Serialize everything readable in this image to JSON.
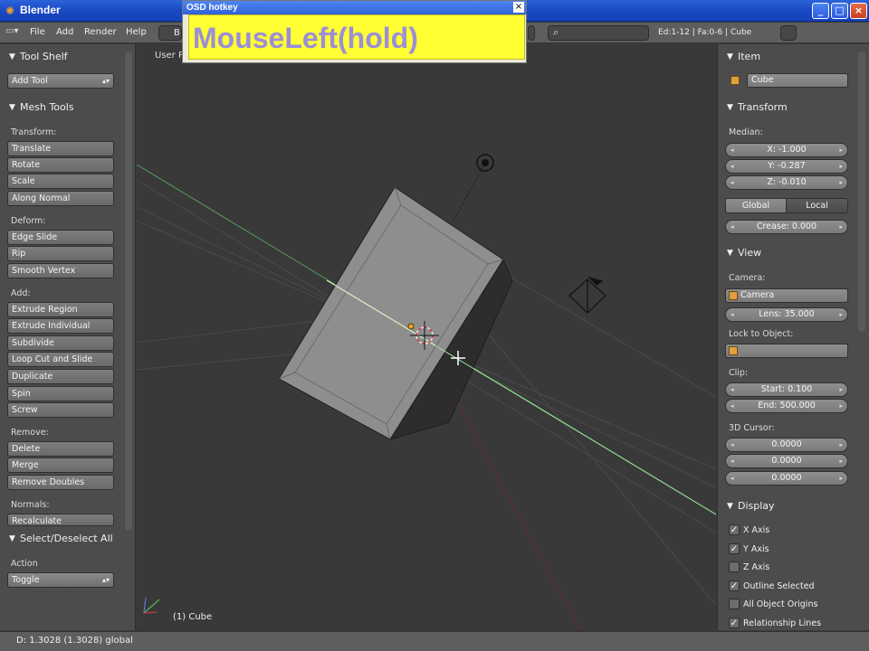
{
  "window": {
    "title": "Blender",
    "buttons": [
      "_",
      "□",
      "×"
    ]
  },
  "menubar": {
    "items": [
      "File",
      "Add",
      "Render",
      "Help"
    ],
    "layout_stub": "B",
    "stats": "Ed:1-12 | Fa:0-6 | Cube"
  },
  "osd": {
    "title": "OSD hotkey",
    "text": "MouseLeft(hold)",
    "close": "×"
  },
  "toolshelf": {
    "tool_shelf": "Tool Shelf",
    "add_tool": "Add Tool",
    "mesh_tools": "Mesh Tools",
    "transform_label": "Transform:",
    "transform": [
      "Translate",
      "Rotate",
      "Scale",
      "Along Normal"
    ],
    "deform_label": "Deform:",
    "deform": [
      "Edge Slide",
      "Rip",
      "Smooth Vertex"
    ],
    "add_label": "Add:",
    "add": [
      "Extrude Region",
      "Extrude Individual",
      "Subdivide",
      "Loop Cut and Slide",
      "Duplicate",
      "Spin",
      "Screw"
    ],
    "remove_label": "Remove:",
    "remove": [
      "Delete",
      "Merge",
      "Remove Doubles"
    ],
    "normals_label": "Normals:",
    "normals": [
      "Recalculate"
    ],
    "select_all": "Select/Deselect All",
    "action_label": "Action",
    "action_value": "Toggle"
  },
  "viewport": {
    "view_label": "User P",
    "object_label": "(1) Cube"
  },
  "props": {
    "item": "Item",
    "item_name": "Cube",
    "transform": "Transform",
    "median": "Median:",
    "x": "X: -1.000",
    "y": "Y: -0.287",
    "z": "Z: -0.010",
    "global": "Global",
    "local": "Local",
    "crease": "Crease: 0.000",
    "view": "View",
    "camera_label": "Camera:",
    "camera_value": "Camera",
    "lens": "Lens: 35.000",
    "lock_label": "Lock to Object:",
    "clip_label": "Clip:",
    "clip_start": "Start: 0.100",
    "clip_end": "End: 500.000",
    "cursor_label": "3D Cursor:",
    "cursor": [
      "0.0000",
      "0.0000",
      "0.0000"
    ],
    "display": "Display",
    "display_opts": [
      {
        "label": "X Axis",
        "checked": true
      },
      {
        "label": "Y Axis",
        "checked": true
      },
      {
        "label": "Z Axis",
        "checked": false
      },
      {
        "label": "Outline Selected",
        "checked": true
      },
      {
        "label": "All Object Origins",
        "checked": false
      },
      {
        "label": "Relationship Lines",
        "checked": true
      }
    ]
  },
  "statusbar": {
    "text": "D: 1.3028 (1.3028) global"
  }
}
